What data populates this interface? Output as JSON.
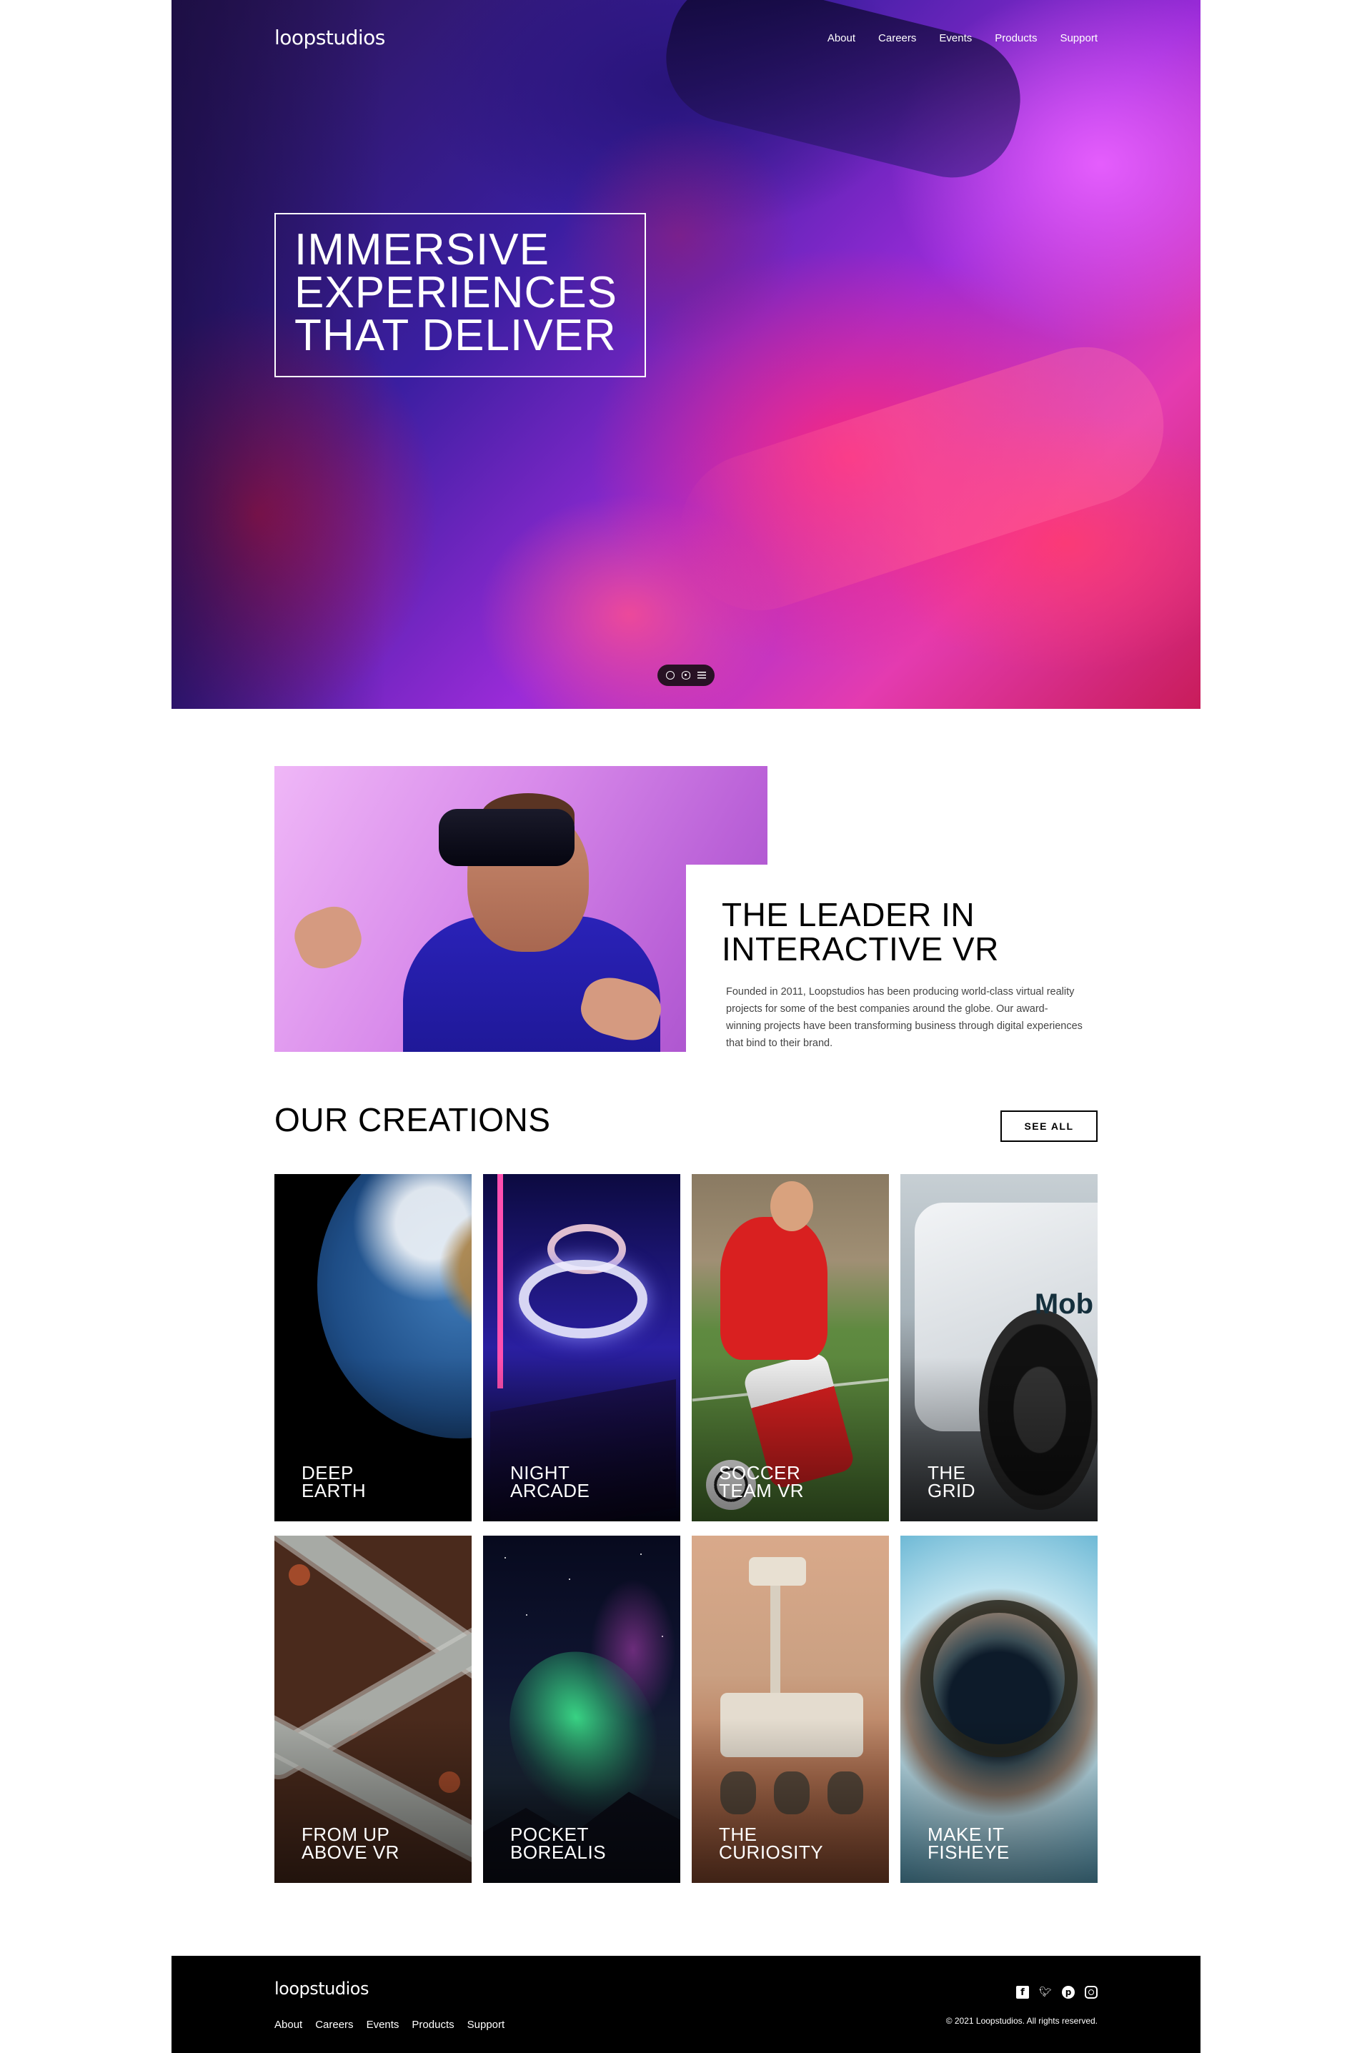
{
  "header": {
    "logo": "loopstudios",
    "nav": [
      "About",
      "Careers",
      "Events",
      "Products",
      "Support"
    ]
  },
  "hero": {
    "title_lines": [
      "IMMERSIVE",
      "EXPERIENCES",
      "THAT DELIVER"
    ]
  },
  "intro": {
    "title_lines": [
      "THE LEADER IN",
      "INTERACTIVE VR"
    ],
    "body": "Founded in 2011, Loopstudios has been producing world-class virtual reality projects for some of the best companies around the globe. Our award-winning projects have been transforming business through digital experiences that bind to their brand."
  },
  "creations": {
    "title": "OUR CREATIONS",
    "see_all": "SEE ALL",
    "items": [
      {
        "lines": [
          "DEEP",
          "EARTH"
        ]
      },
      {
        "lines": [
          "NIGHT",
          "ARCADE"
        ]
      },
      {
        "lines": [
          "SOCCER",
          "TEAM VR"
        ]
      },
      {
        "lines": [
          "THE",
          "GRID"
        ]
      },
      {
        "lines": [
          "FROM UP",
          "ABOVE VR"
        ]
      },
      {
        "lines": [
          "POCKET",
          "BOREALIS"
        ]
      },
      {
        "lines": [
          "THE",
          "CURIOSITY"
        ]
      },
      {
        "lines": [
          "MAKE IT",
          "FISHEYE"
        ]
      }
    ],
    "card_art_brand": "Mob"
  },
  "footer": {
    "logo": "loopstudios",
    "nav": [
      "About",
      "Careers",
      "Events",
      "Products",
      "Support"
    ],
    "socials": [
      "facebook-icon",
      "twitter-icon",
      "pinterest-icon",
      "instagram-icon"
    ],
    "copyright": "© 2021 Loopstudios. All rights reserved."
  },
  "colors": {
    "footer_bg": "#000000",
    "text_primary": "#000000",
    "hero_accent": "#e43bb0"
  }
}
